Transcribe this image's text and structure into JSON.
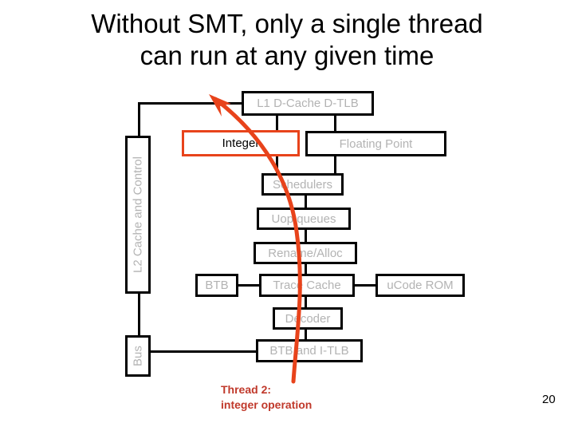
{
  "slide": {
    "title": "Without SMT, only a single thread\ncan run at any given time",
    "page_number": "20",
    "caption": "Thread 2:\ninteger operation",
    "colors": {
      "highlight": "#e8431b",
      "caption": "#c0392b",
      "box_border": "#000000",
      "box_text": "#b3b3b3",
      "highlight_text": "#000000",
      "background": "#ffffff"
    }
  },
  "diagram": {
    "name": "cpu-pipeline-block-diagram",
    "boxes": [
      {
        "id": "l1-d-cache",
        "label": "L1 D-Cache D-TLB",
        "highlight": false,
        "orientation": "horizontal"
      },
      {
        "id": "integer",
        "label": "Integer",
        "highlight": true,
        "orientation": "horizontal"
      },
      {
        "id": "floating-point",
        "label": "Floating Point",
        "highlight": false,
        "orientation": "horizontal"
      },
      {
        "id": "schedulers",
        "label": "Schedulers",
        "highlight": false,
        "orientation": "horizontal"
      },
      {
        "id": "uop-queues",
        "label": "Uop queues",
        "highlight": false,
        "orientation": "horizontal"
      },
      {
        "id": "rename-alloc",
        "label": "Rename/Alloc",
        "highlight": false,
        "orientation": "horizontal"
      },
      {
        "id": "btb",
        "label": "BTB",
        "highlight": false,
        "orientation": "horizontal"
      },
      {
        "id": "trace-cache",
        "label": "Trace Cache",
        "highlight": false,
        "orientation": "horizontal"
      },
      {
        "id": "ucode-rom",
        "label": "uCode ROM",
        "highlight": false,
        "orientation": "horizontal"
      },
      {
        "id": "decoder",
        "label": "Decoder",
        "highlight": false,
        "orientation": "horizontal"
      },
      {
        "id": "btb-itlb",
        "label": "BTB and I-TLB",
        "highlight": false,
        "orientation": "horizontal"
      },
      {
        "id": "l2-cache",
        "label": "L2 Cache and Control",
        "highlight": false,
        "orientation": "vertical"
      },
      {
        "id": "bus",
        "label": "Bus",
        "highlight": false,
        "orientation": "vertical"
      }
    ],
    "annotation": {
      "id": "thread-2-arrow",
      "label": "Thread 2: integer operation",
      "color": "#e8431b",
      "points_to": "L1 D-Cache D-TLB"
    }
  }
}
